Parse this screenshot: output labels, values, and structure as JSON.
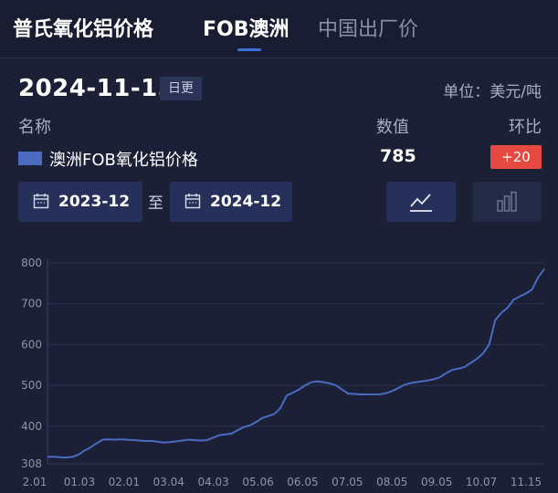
{
  "header": {
    "brand": "普氏氧化铝价格",
    "tabs": [
      {
        "label": "FOB澳洲",
        "active": true
      },
      {
        "label": "中国出厂价",
        "active": false
      }
    ]
  },
  "info": {
    "date": "2024-11-15",
    "frequency": "日更",
    "unit": "单位：美元/吨"
  },
  "columns": {
    "name": "名称",
    "value": "数值",
    "change": "环比"
  },
  "series_row": {
    "name": "澳洲FOB氧化铝价格",
    "value": "785",
    "change": "+20",
    "color": "#4a6bbf",
    "change_color": "#e5493f"
  },
  "range": {
    "start": "2023-12",
    "separator": "至",
    "end": "2024-12"
  },
  "chart_buttons": {
    "line_icon": "line-chart-icon",
    "bar_icon": "bar-chart-icon"
  },
  "chart_data": {
    "type": "line",
    "title": "",
    "xlabel": "",
    "ylabel": "",
    "yticks": [
      "800",
      "700",
      "600",
      "500",
      "400",
      "308"
    ],
    "ylim": [
      308,
      800
    ],
    "xticks": [
      "2.01",
      "01.03",
      "02.01",
      "03.04",
      "04.03",
      "05.06",
      "06.05",
      "07.05",
      "08.05",
      "09.05",
      "10.07",
      "11.15"
    ],
    "grid": true,
    "series": [
      {
        "color": "#4a6bbf",
        "values": [
          325,
          325,
          324,
          323,
          325,
          330,
          340,
          348,
          358,
          367,
          368,
          367,
          368,
          367,
          366,
          365,
          364,
          364,
          362,
          360,
          361,
          363,
          365,
          367,
          366,
          365,
          366,
          372,
          378,
          380,
          382,
          390,
          398,
          402,
          410,
          420,
          425,
          430,
          445,
          475,
          482,
          490,
          500,
          508,
          510,
          508,
          505,
          500,
          490,
          480,
          479,
          478,
          478,
          478,
          478,
          480,
          485,
          492,
          500,
          505,
          508,
          510,
          512,
          515,
          520,
          530,
          538,
          541,
          545,
          555,
          565,
          578,
          600,
          660,
          678,
          690,
          710,
          718,
          725,
          735,
          765,
          785
        ]
      }
    ]
  }
}
